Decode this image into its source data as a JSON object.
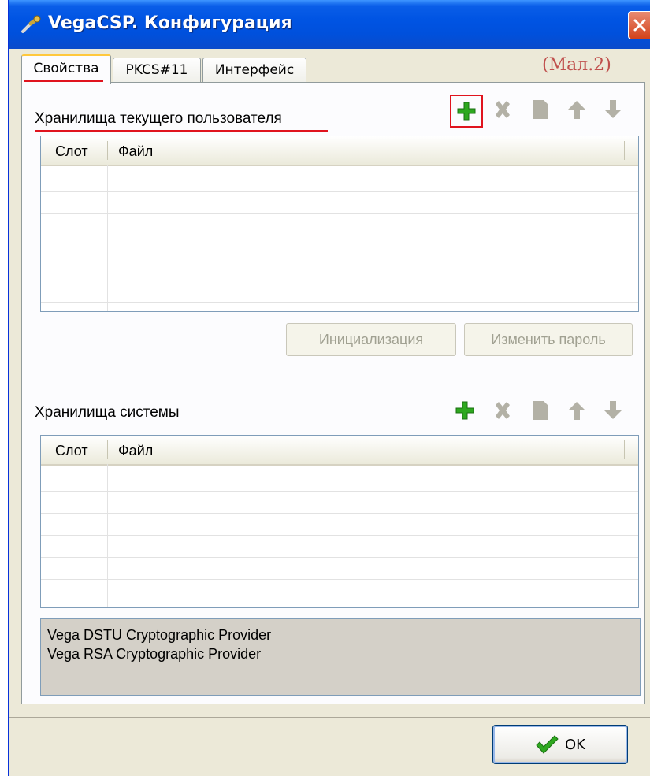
{
  "window": {
    "title": "VegaCSP. Конфигурация",
    "annotation": "(Мал.2)"
  },
  "tabs": [
    {
      "label": "Свойства",
      "active": true
    },
    {
      "label": "PKCS#11",
      "active": false
    },
    {
      "label": "Интерфейс",
      "active": false
    }
  ],
  "user_stores": {
    "label": "Хранилища текущего пользователя",
    "columns": {
      "slot": "Слот",
      "file": "Файл"
    },
    "init_button": "Инициализация",
    "change_password_button": "Изменить пароль"
  },
  "system_stores": {
    "label": "Хранилища системы",
    "columns": {
      "slot": "Слот",
      "file": "Файл"
    }
  },
  "providers": [
    "Vega DSTU Cryptographic Provider",
    "Vega RSA Cryptographic Provider"
  ],
  "ok_button": "OK",
  "icons": {
    "add": "plus-icon",
    "delete": "x-icon",
    "copy": "document-icon",
    "up": "arrow-up-icon",
    "down": "arrow-down-icon"
  },
  "colors": {
    "titlebar": "#0054e3",
    "highlight": "#e0141e",
    "add_icon": "#2ea81f",
    "disabled_icon": "#b3b1a6"
  }
}
